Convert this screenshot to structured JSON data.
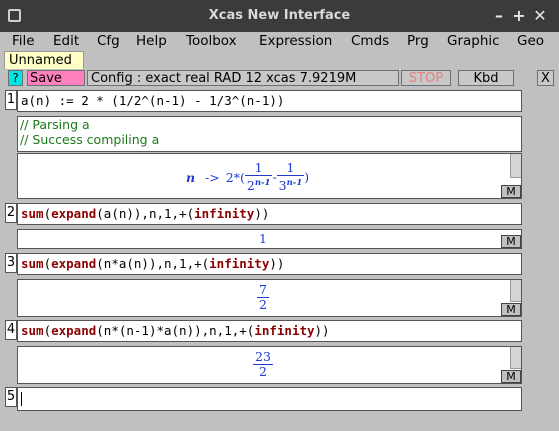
{
  "window": {
    "title": "Xcas New Interface",
    "minimize": "–",
    "maximize": "+",
    "close": "✕"
  },
  "menu": [
    "File",
    "Edit",
    "Cfg",
    "Help",
    "Toolbox",
    "Expression",
    "Cmds",
    "Prg",
    "Graphic",
    "Geo"
  ],
  "tab": {
    "label": "Unnamed"
  },
  "toolbar": {
    "help": "?",
    "save": "Save",
    "config": "Config  : exact real RAD 12 xcas 7.9219M",
    "stop": "STOP",
    "kbd": "Kbd",
    "close": "X"
  },
  "levels": [
    {
      "num": "1",
      "input_plain": "a(n) := 2 * (1/2^(n-1) - 1/3^(n-1))",
      "log": [
        "// Parsing a",
        "// Success compiling a"
      ],
      "output": {
        "var": "n",
        "arrow": "->",
        "coef": "2*(",
        "f1_num": "1",
        "f1_den_base": "2",
        "f1_exp": "n-1",
        "minus": "-",
        "f2_num": "1",
        "f2_den_base": "3",
        "f2_exp": "n-1",
        "close": ")"
      }
    },
    {
      "num": "2",
      "fn1": "sum",
      "p1": "(",
      "fn2": "expand",
      "p2": "(a(n)),n,1,+(",
      "fn3": "infinity",
      "p3": "))",
      "result": "1"
    },
    {
      "num": "3",
      "fn1": "sum",
      "p1": "(",
      "fn2": "expand",
      "p2": "(n*a(n)),n,1,+(",
      "fn3": "infinity",
      "p3": "))",
      "res_num": "7",
      "res_den": "2"
    },
    {
      "num": "4",
      "fn1": "sum",
      "p1": "(",
      "fn2": "expand",
      "p2": "(n*(n-1)*a(n)),n,1,+(",
      "fn3": "infinity",
      "p3": "))",
      "res_num": "23",
      "res_den": "2"
    },
    {
      "num": "5",
      "input_plain": ""
    }
  ],
  "m_button": "M"
}
